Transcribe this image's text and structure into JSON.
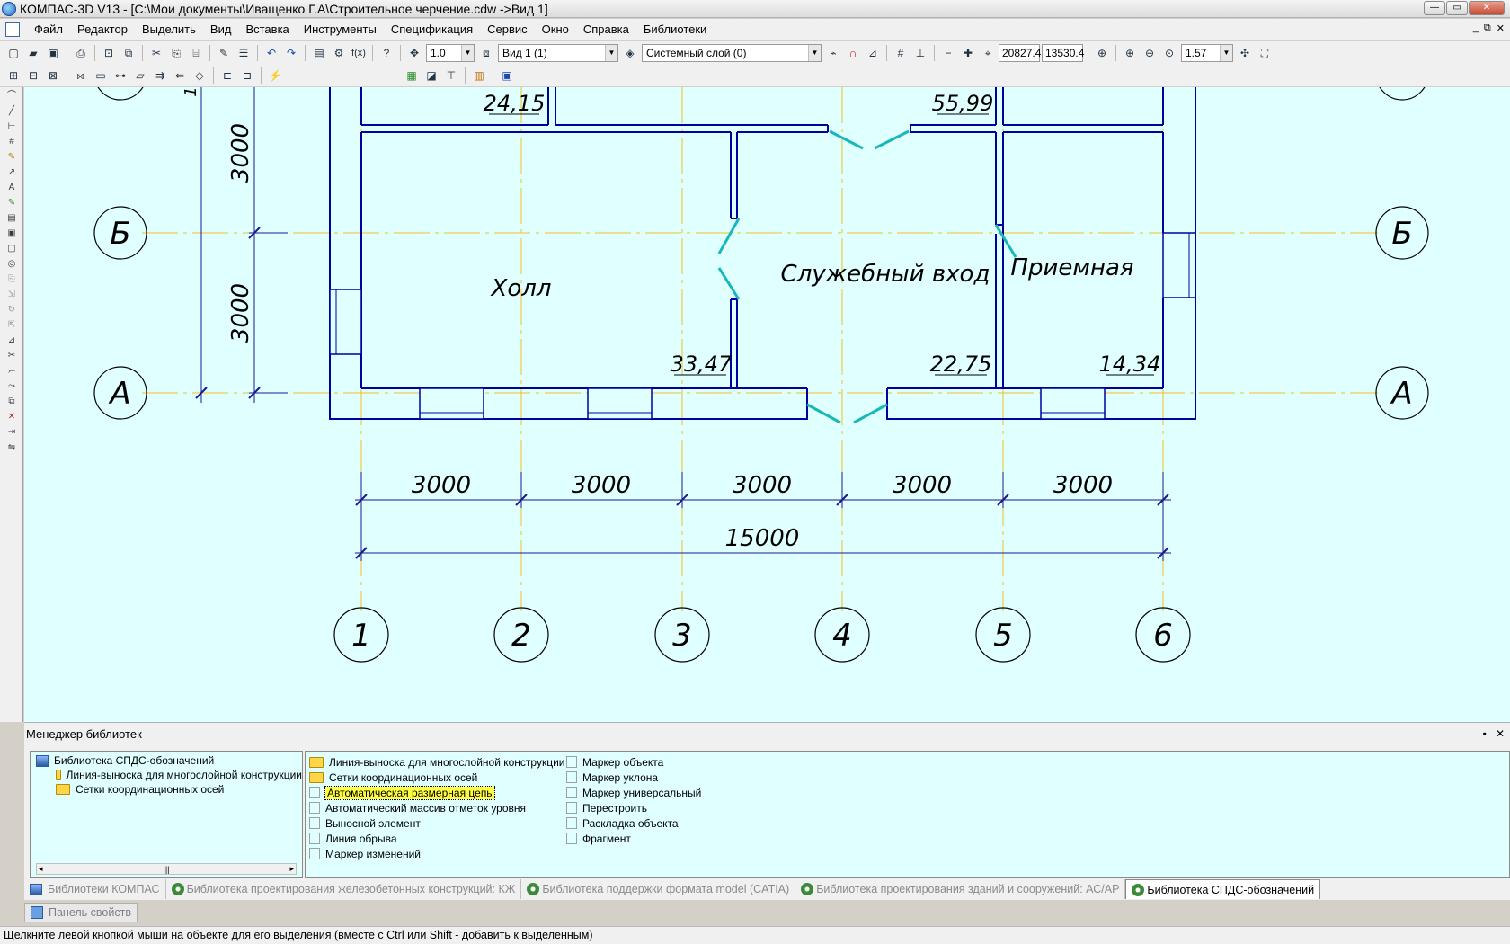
{
  "window": {
    "title": "КОМПАС-3D V13 - [C:\\Мои документы\\Иващенко Г.А\\Строительное черчение.cdw ->Вид 1]",
    "min": "—",
    "max": "▭",
    "close": "✕"
  },
  "menu": [
    "Файл",
    "Редактор",
    "Выделить",
    "Вид",
    "Вставка",
    "Инструменты",
    "Спецификация",
    "Сервис",
    "Окно",
    "Справка",
    "Библиотеки"
  ],
  "mdi_buttons": [
    "_",
    "⧉",
    "✕"
  ],
  "toolbar": {
    "step": "1.0",
    "view": "Вид 1 (1)",
    "layer": "Системный слой (0)",
    "coord_x": "20827.4",
    "coord_y": "13530.4",
    "zoom": "1.57"
  },
  "drawing": {
    "row_axes": [
      "Б",
      "А"
    ],
    "col_axes": [
      "1",
      "2",
      "3",
      "4",
      "5",
      "6"
    ],
    "rooms": [
      "Холл",
      "Служебный вход",
      "Приемная"
    ],
    "areas": [
      "24,15",
      "55,99",
      "33,47",
      "22,75",
      "14,34"
    ],
    "dims_bays": [
      "3000",
      "3000",
      "3000",
      "3000",
      "3000"
    ],
    "dim_total": "15000",
    "dims_vertical": [
      "3000",
      "3000"
    ],
    "dim_cut": "1"
  },
  "library_manager": {
    "title": "Менеджер библиотек",
    "pin": "▪",
    "close": "✕",
    "tree": {
      "root": "Библиотека СПДС-обозначений",
      "children": [
        "Линия-выноска для многослойной конструкции",
        "Сетки координационных осей"
      ]
    },
    "items_col1": [
      {
        "label": "Линия-выноска для многослойной конструкции",
        "type": "folder"
      },
      {
        "label": "Сетки координационных осей",
        "type": "folder"
      },
      {
        "label": "Автоматическая размерная цепь",
        "type": "item",
        "selected": true
      },
      {
        "label": "Автоматический массив отметок уровня",
        "type": "item"
      },
      {
        "label": "Выносной элемент",
        "type": "item"
      },
      {
        "label": "Линия обрыва",
        "type": "item"
      },
      {
        "label": "Маркер изменений",
        "type": "item"
      }
    ],
    "items_col2": [
      {
        "label": "Маркер объекта"
      },
      {
        "label": "Маркер уклона"
      },
      {
        "label": "Маркер универсальный"
      },
      {
        "label": "Перестроить"
      },
      {
        "label": "Раскладка объекта"
      },
      {
        "label": "Фрагмент"
      }
    ],
    "tabs": [
      {
        "label": "Библиотеки КОМПАС",
        "active": false
      },
      {
        "label": "Библиотека проектирования железобетонных конструкций: КЖ",
        "active": false
      },
      {
        "label": "Библиотека поддержки формата model (CATIA)",
        "active": false
      },
      {
        "label": "Библиотека проектирования зданий и сооружений: АС/АР",
        "active": false
      },
      {
        "label": "Библиотека СПДС-обозначений",
        "active": true
      }
    ]
  },
  "properties_tab": "Панель свойств",
  "status": "Щелкните левой кнопкой мыши на объекте для его выделения (вместе с Ctrl или Shift - добавить к выделенным)",
  "colors": {
    "canvas": "#e0ffff",
    "wall": "#0000a0",
    "axis": "#f0c020",
    "door": "#18b8b8",
    "dim": "#1a1a8a"
  }
}
